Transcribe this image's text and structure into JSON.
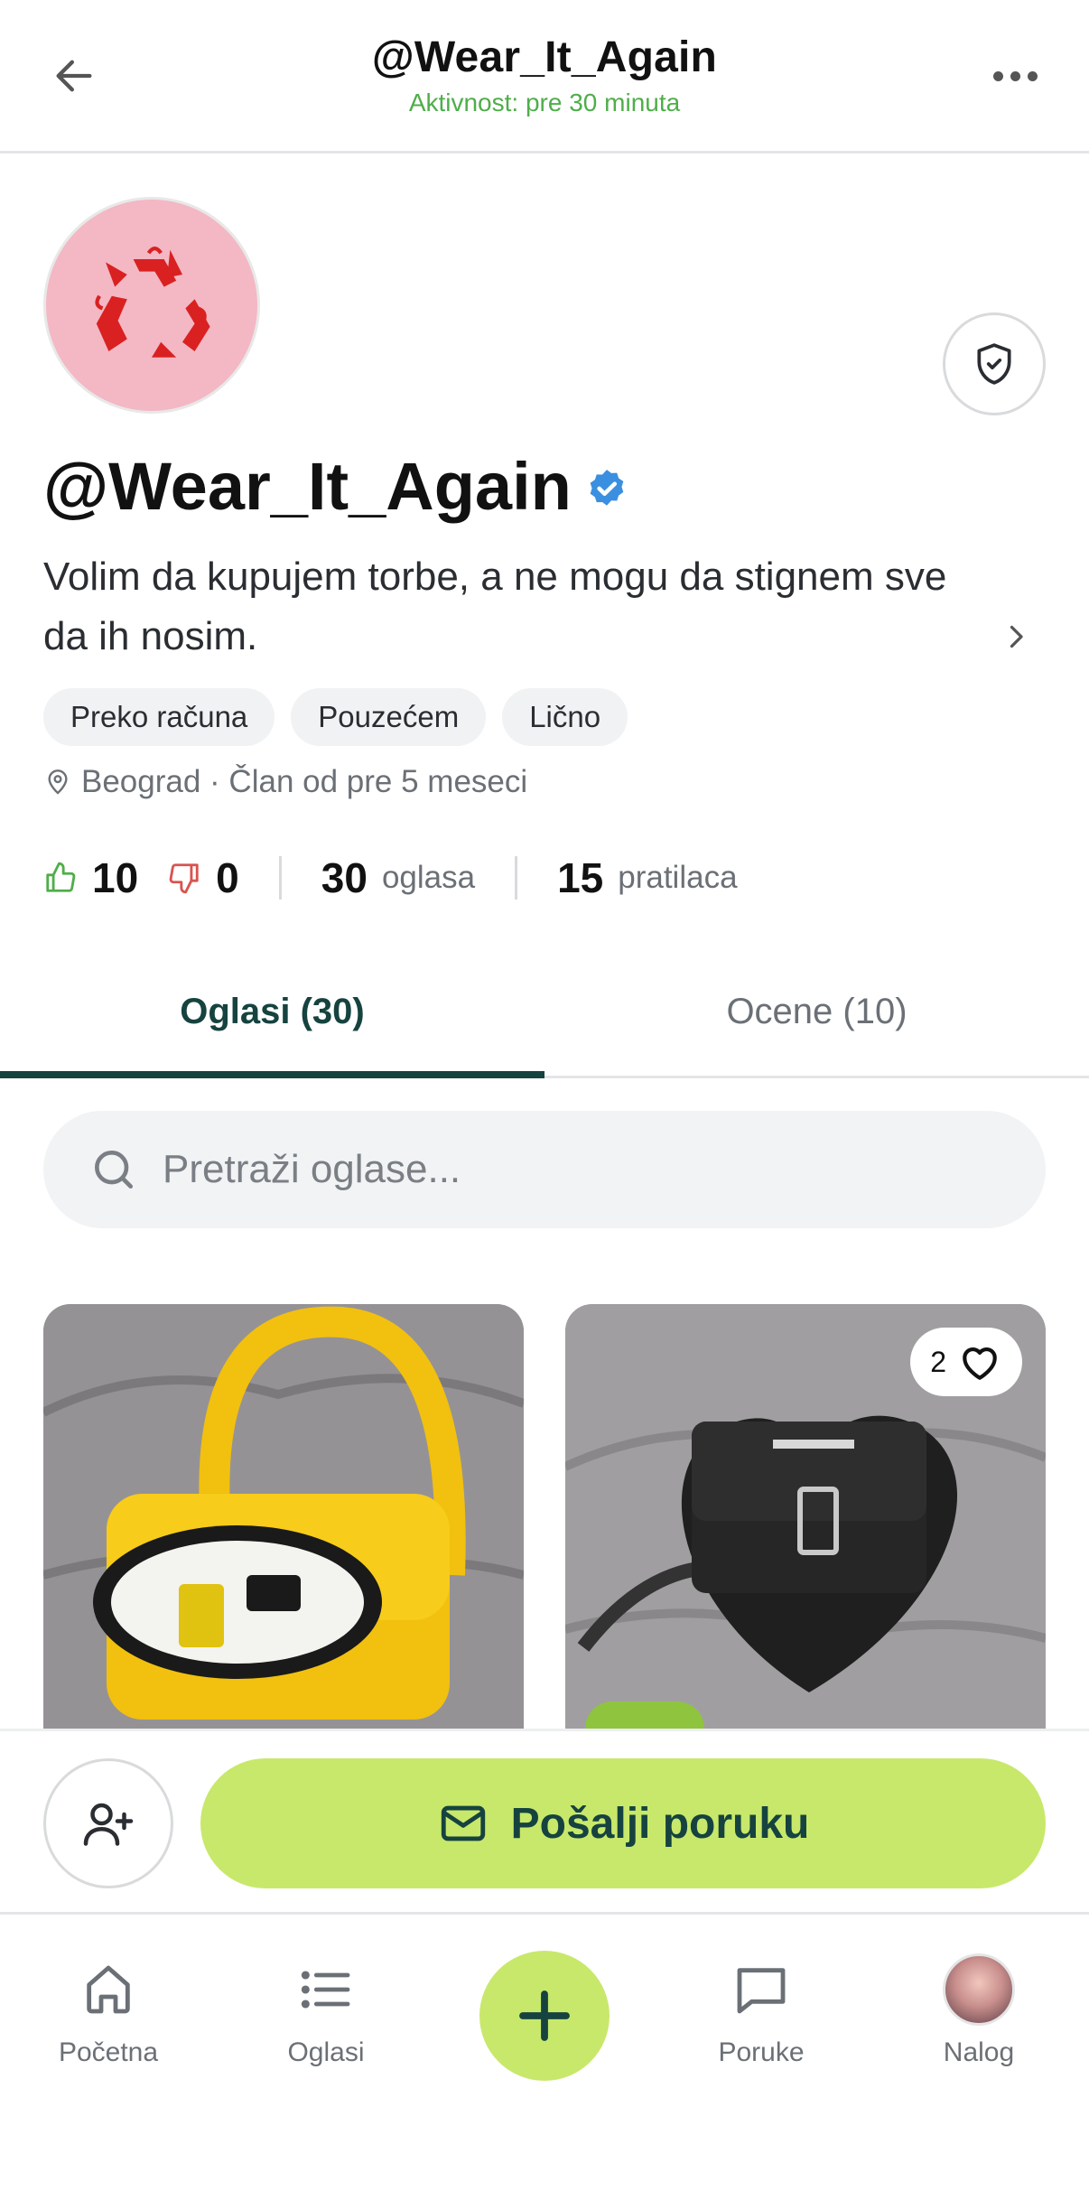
{
  "header": {
    "title": "@Wear_It_Again",
    "subtitle": "Aktivnost: pre 30 minuta"
  },
  "profile": {
    "username": "@Wear_It_Again",
    "bio": "Volim da kupujem torbe, a ne mogu da stignem sve da ih nosim.",
    "payment_chips": [
      "Preko računa",
      "Pouzećem",
      "Lično"
    ],
    "location_line": "Beograd · Član od pre 5 meseci",
    "likes": "10",
    "dislikes": "0",
    "listings_count": "30",
    "listings_label": "oglasa",
    "followers_count": "15",
    "followers_label": "pratilaca"
  },
  "tabs": [
    {
      "label": "Oglasi (30)",
      "active": true
    },
    {
      "label": "Ocene (10)",
      "active": false
    }
  ],
  "search": {
    "placeholder": "Pretraži oglase..."
  },
  "listings": [
    {
      "image_icon": "yellow-bag-photo"
    },
    {
      "image_icon": "black-heart-bag-photo",
      "favorites": "2"
    }
  ],
  "actions": {
    "message_label": "Pošalji poruku"
  },
  "bottom_nav": [
    {
      "label": "Početna",
      "icon": "home-icon"
    },
    {
      "label": "Oglasi",
      "icon": "list-icon"
    },
    {
      "label": "",
      "icon": "plus-icon"
    },
    {
      "label": "Poruke",
      "icon": "chat-icon"
    },
    {
      "label": "Nalog",
      "icon": "avatar"
    }
  ],
  "colors": {
    "accent_green": "#c8e86b",
    "dark_teal": "#16433f",
    "status_green": "#4fae4a",
    "verified_blue": "#3b8fe0"
  }
}
